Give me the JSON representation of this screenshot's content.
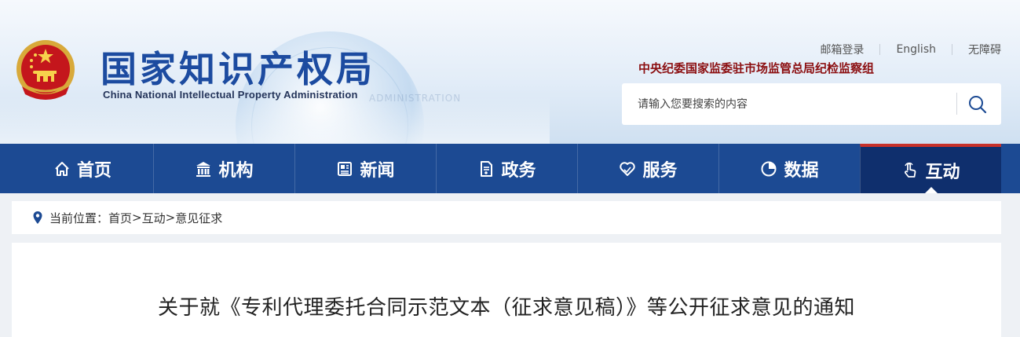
{
  "header": {
    "site_title": "国家知识产权局",
    "site_subtitle": "China National Intellectual Property Administration",
    "watermark": "ADMINISTRATION",
    "top_links": [
      "邮箱登录",
      "English",
      "无障碍"
    ],
    "discipline_text": "中央纪委国家监委驻市场监管总局纪检监察组",
    "search": {
      "placeholder": "请输入您要搜索的内容",
      "value": ""
    }
  },
  "nav": {
    "items": [
      {
        "label": "首页",
        "icon": "home-icon"
      },
      {
        "label": "机构",
        "icon": "institution-icon"
      },
      {
        "label": "新闻",
        "icon": "newspaper-icon"
      },
      {
        "label": "政务",
        "icon": "document-icon"
      },
      {
        "label": "服务",
        "icon": "service-heart-icon"
      },
      {
        "label": "数据",
        "icon": "pie-chart-icon"
      },
      {
        "label": "互动",
        "icon": "hand-pointer-icon"
      }
    ],
    "active": "互动"
  },
  "breadcrumb": {
    "prefix": "当前位置：",
    "items": [
      "首页",
      "互动",
      "意见征求"
    ],
    "separator": ">"
  },
  "article": {
    "title": "关于就《专利代理委托合同示范文本（征求意见稿）》等公开征求意见的通知"
  },
  "colors": {
    "nav_bg": "#1c4a93",
    "nav_active_bg": "#0f2f6d",
    "nav_active_accent": "#c8312a",
    "title_blue": "#1c4ba0",
    "discipline_red": "#8b0e10"
  }
}
